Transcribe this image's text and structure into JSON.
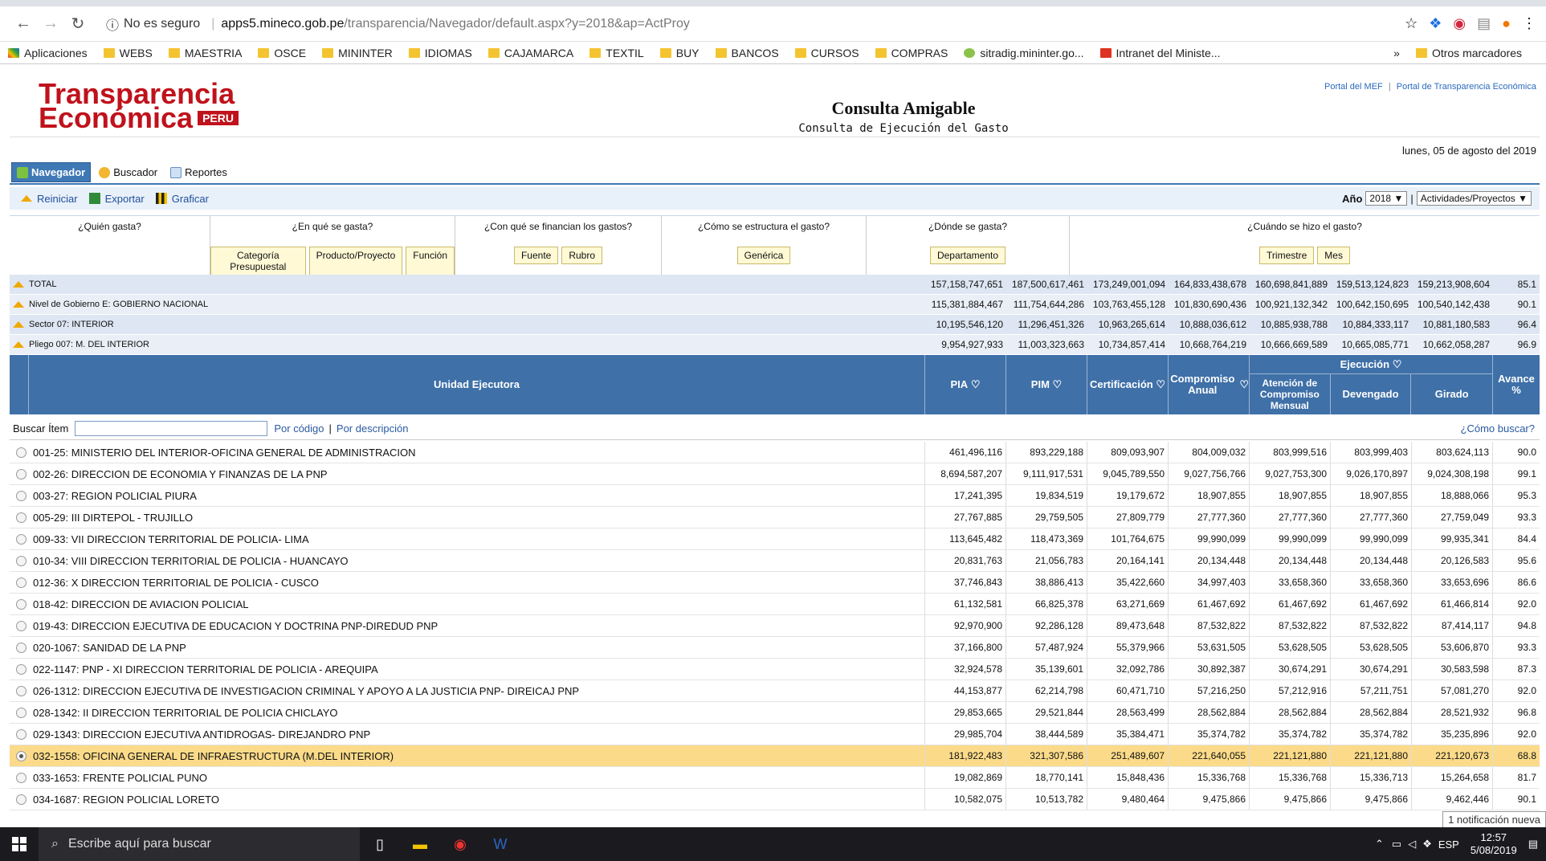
{
  "browser": {
    "security": "No es seguro",
    "url_domain": "apps5.mineco.gob.pe",
    "url_path": "/transparencia/Navegador/default.aspx?y=2018&ap=ActProy",
    "bookmarks": [
      {
        "label": "Aplicaciones",
        "icon": "apps-grid-icon"
      },
      {
        "label": "WEBS",
        "icon": "folder-icon"
      },
      {
        "label": "MAESTRIA",
        "icon": "folder-icon"
      },
      {
        "label": "OSCE",
        "icon": "folder-icon"
      },
      {
        "label": "MININTER",
        "icon": "folder-icon"
      },
      {
        "label": "IDIOMAS",
        "icon": "folder-icon"
      },
      {
        "label": "CAJAMARCA",
        "icon": "folder-icon"
      },
      {
        "label": "TEXTIL",
        "icon": "folder-icon"
      },
      {
        "label": "BUY",
        "icon": "folder-icon"
      },
      {
        "label": "BANCOS",
        "icon": "folder-icon"
      },
      {
        "label": "CURSOS",
        "icon": "folder-icon"
      },
      {
        "label": "COMPRAS",
        "icon": "folder-icon"
      },
      {
        "label": "sitradig.mininter.go...",
        "icon": "leaf-icon"
      },
      {
        "label": "Intranet del Ministe...",
        "icon": "mi-icon"
      }
    ],
    "more": "»",
    "other_bookmarks": "Otros marcadores"
  },
  "site": {
    "logo_line1": "Transparencia",
    "logo_line2": "Económica",
    "logo_peru": "PERU",
    "top_link1": "Portal del MEF",
    "top_sep": "|",
    "top_link2": "Portal de Transparencia Económica",
    "title": "Consulta Amigable",
    "subtitle": "Consulta de Ejecución del Gasto",
    "date": "lunes, 05 de agosto del 2019"
  },
  "tabs": {
    "nav": "Navegador",
    "search": "Buscador",
    "reports": "Reportes"
  },
  "toolbar": {
    "reset": "Reiniciar",
    "export": "Exportar",
    "chart": "Graficar",
    "year_label": "Año",
    "year_value": "2018",
    "sep": "|",
    "activities_value": "Actividades/Proyectos"
  },
  "questions": [
    {
      "q": "¿Quién gasta?",
      "buttons": []
    },
    {
      "q": "¿En qué se gasta?",
      "buttons": [
        "Categoría Presupuestal",
        "Producto/Proyecto",
        "Función"
      ]
    },
    {
      "q": "¿Con qué se financian los gastos?",
      "buttons": [
        "Fuente",
        "Rubro"
      ]
    },
    {
      "q": "¿Cómo se estructura el gasto?",
      "buttons": [
        "Genérica"
      ]
    },
    {
      "q": "¿Dónde se gasta?",
      "buttons": [
        "Departamento"
      ]
    },
    {
      "q": "¿Cuándo se hizo el gasto?",
      "buttons": [
        "Trimestre",
        "Mes"
      ]
    }
  ],
  "summary": [
    {
      "label": "TOTAL",
      "v": [
        "157,158,747,651",
        "187,500,617,461",
        "173,249,001,094",
        "164,833,438,678",
        "160,698,841,889",
        "159,513,124,823",
        "159,213,908,604",
        "85.1"
      ]
    },
    {
      "label": "Nivel de Gobierno E: GOBIERNO NACIONAL",
      "v": [
        "115,381,884,467",
        "111,754,644,286",
        "103,763,455,128",
        "101,830,690,436",
        "100,921,132,342",
        "100,642,150,695",
        "100,540,142,438",
        "90.1"
      ]
    },
    {
      "label": "Sector 07: INTERIOR",
      "v": [
        "10,195,546,120",
        "11,296,451,326",
        "10,963,265,614",
        "10,888,036,612",
        "10,885,938,788",
        "10,884,333,117",
        "10,881,180,583",
        "96.4"
      ]
    },
    {
      "label": "Pliego 007: M. DEL INTERIOR",
      "v": [
        "9,954,927,933",
        "11,003,323,663",
        "10,734,857,414",
        "10,668,764,219",
        "10,666,669,589",
        "10,665,085,771",
        "10,662,058,287",
        "96.9"
      ]
    }
  ],
  "header": {
    "unit": "Unidad Ejecutora",
    "pia": "PIA",
    "pim": "PIM",
    "cert": "Certificación",
    "comp_anual": "Compromiso Anual",
    "ejecucion": "Ejecución",
    "atencion": "Atención de Compromiso Mensual",
    "devengado": "Devengado",
    "girado": "Girado",
    "avance": "Avance %"
  },
  "search": {
    "label": "Buscar Ítem",
    "by_code": "Por código",
    "sep": "|",
    "by_desc": "Por descripción",
    "how": "¿Cómo buscar?"
  },
  "rows": [
    {
      "name": "001-25: MINISTERIO DEL INTERIOR-OFICINA GENERAL DE ADMINISTRACION",
      "v": [
        "461,496,116",
        "893,229,188",
        "809,093,907",
        "804,009,032",
        "803,999,516",
        "803,999,403",
        "803,624,113",
        "90.0"
      ]
    },
    {
      "name": "002-26: DIRECCION DE ECONOMIA Y FINANZAS DE LA PNP",
      "v": [
        "8,694,587,207",
        "9,111,917,531",
        "9,045,789,550",
        "9,027,756,766",
        "9,027,753,300",
        "9,026,170,897",
        "9,024,308,198",
        "99.1"
      ]
    },
    {
      "name": "003-27: REGION POLICIAL PIURA",
      "v": [
        "17,241,395",
        "19,834,519",
        "19,179,672",
        "18,907,855",
        "18,907,855",
        "18,907,855",
        "18,888,066",
        "95.3"
      ]
    },
    {
      "name": "005-29: III DIRTEPOL - TRUJILLO",
      "v": [
        "27,767,885",
        "29,759,505",
        "27,809,779",
        "27,777,360",
        "27,777,360",
        "27,777,360",
        "27,759,049",
        "93.3"
      ]
    },
    {
      "name": "009-33: VII DIRECCION TERRITORIAL DE POLICIA- LIMA",
      "v": [
        "113,645,482",
        "118,473,369",
        "101,764,675",
        "99,990,099",
        "99,990,099",
        "99,990,099",
        "99,935,341",
        "84.4"
      ]
    },
    {
      "name": "010-34: VIII DIRECCION TERRITORIAL DE POLICIA - HUANCAYO",
      "v": [
        "20,831,763",
        "21,056,783",
        "20,164,141",
        "20,134,448",
        "20,134,448",
        "20,134,448",
        "20,126,583",
        "95.6"
      ]
    },
    {
      "name": "012-36: X DIRECCION TERRITORIAL DE POLICIA - CUSCO",
      "v": [
        "37,746,843",
        "38,886,413",
        "35,422,660",
        "34,997,403",
        "33,658,360",
        "33,658,360",
        "33,653,696",
        "86.6"
      ]
    },
    {
      "name": "018-42: DIRECCION DE AVIACION POLICIAL",
      "v": [
        "61,132,581",
        "66,825,378",
        "63,271,669",
        "61,467,692",
        "61,467,692",
        "61,467,692",
        "61,466,814",
        "92.0"
      ]
    },
    {
      "name": "019-43: DIRECCION EJECUTIVA DE EDUCACION Y DOCTRINA PNP-DIREDUD PNP",
      "v": [
        "92,970,900",
        "92,286,128",
        "89,473,648",
        "87,532,822",
        "87,532,822",
        "87,532,822",
        "87,414,117",
        "94.8"
      ]
    },
    {
      "name": "020-1067: SANIDAD DE LA PNP",
      "v": [
        "37,166,800",
        "57,487,924",
        "55,379,966",
        "53,631,505",
        "53,628,505",
        "53,628,505",
        "53,606,870",
        "93.3"
      ]
    },
    {
      "name": "022-1147: PNP - XI DIRECCION TERRITORIAL DE POLICIA - AREQUIPA",
      "v": [
        "32,924,578",
        "35,139,601",
        "32,092,786",
        "30,892,387",
        "30,674,291",
        "30,674,291",
        "30,583,598",
        "87.3"
      ]
    },
    {
      "name": "026-1312: DIRECCION EJECUTIVA DE INVESTIGACION CRIMINAL Y APOYO A LA JUSTICIA PNP- DIREICAJ PNP",
      "v": [
        "44,153,877",
        "62,214,798",
        "60,471,710",
        "57,216,250",
        "57,212,916",
        "57,211,751",
        "57,081,270",
        "92.0"
      ]
    },
    {
      "name": "028-1342: II DIRECCION TERRITORIAL DE POLICIA CHICLAYO",
      "v": [
        "29,853,665",
        "29,521,844",
        "28,563,499",
        "28,562,884",
        "28,562,884",
        "28,562,884",
        "28,521,932",
        "96.8"
      ]
    },
    {
      "name": "029-1343: DIRECCION EJECUTIVA ANTIDROGAS- DIREJANDRO PNP",
      "v": [
        "29,985,704",
        "38,444,589",
        "35,384,471",
        "35,374,782",
        "35,374,782",
        "35,374,782",
        "35,235,896",
        "92.0"
      ]
    },
    {
      "name": "032-1558: OFICINA GENERAL DE INFRAESTRUCTURA (M.DEL INTERIOR)",
      "v": [
        "181,922,483",
        "321,307,586",
        "251,489,607",
        "221,640,055",
        "221,121,880",
        "221,121,880",
        "221,120,673",
        "68.8"
      ],
      "selected": true
    },
    {
      "name": "033-1653: FRENTE POLICIAL PUNO",
      "v": [
        "19,082,869",
        "18,770,141",
        "15,848,436",
        "15,336,768",
        "15,336,768",
        "15,336,713",
        "15,264,658",
        "81.7"
      ]
    },
    {
      "name": "034-1687: REGION POLICIAL LORETO",
      "v": [
        "10,582,075",
        "10,513,782",
        "9,480,464",
        "9,475,866",
        "9,475,866",
        "9,475,866",
        "9,462,446",
        "90.1"
      ]
    }
  ],
  "notification": "1 notificación nueva",
  "taskbar": {
    "search_placeholder": "Escribe aquí para buscar",
    "lang": "ESP",
    "time": "12:57",
    "date": "5/08/2019"
  }
}
